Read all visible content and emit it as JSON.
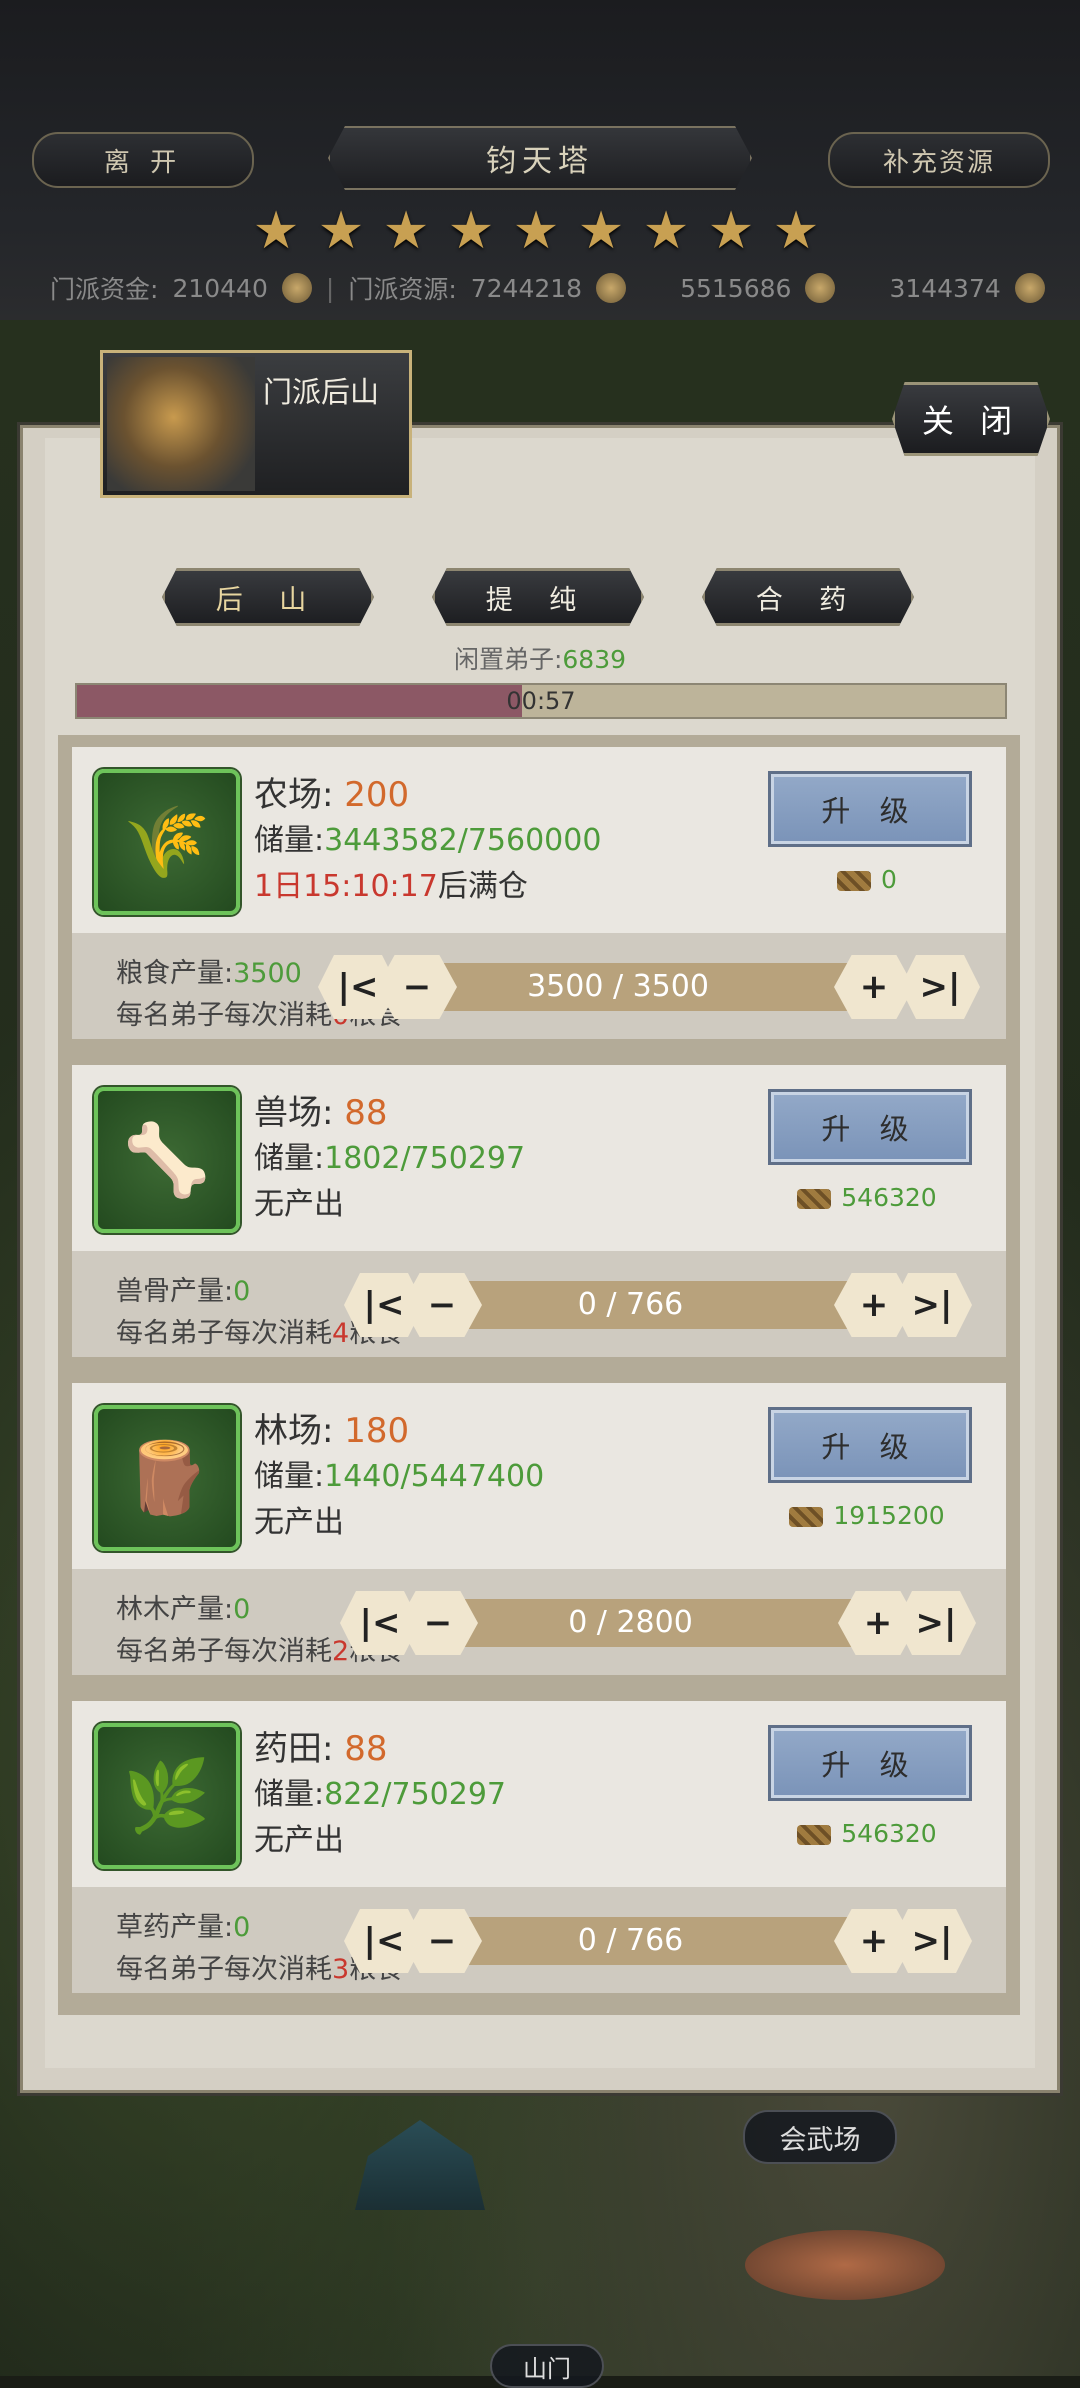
{
  "top": {
    "leave": "离 开",
    "title": "钧天塔",
    "replenish": "补充资源",
    "stars": [
      "★",
      "★",
      "★",
      "★",
      "★",
      "★",
      "★",
      "★",
      "★"
    ],
    "res_label_1": "门派资金:",
    "res_value_1": "210440",
    "res_sep": "|",
    "res_label_2": "门派资源:",
    "res_value_2": "7244218",
    "res_value_3": "5515686",
    "res_value_4": "3144374"
  },
  "panel": {
    "title": "门派后山",
    "close": "关 闭",
    "tabs": [
      "后 山",
      "提 纯",
      "合 药"
    ],
    "idle_label": "闲置弟子:",
    "idle_value": "6839",
    "timer": "00:57",
    "timer_progress": 0.48
  },
  "cards": [
    {
      "name": "农场:",
      "level": "200",
      "store_label": "储量:",
      "store_value": "3443582/7560000",
      "status_red": "1日15:10:17",
      "status_rest": "后满仓",
      "upgrade": "升 级",
      "cost": "0",
      "prod_label": "粮食产量:",
      "prod_value": "3500",
      "consume_pre": "每名弟子每次消耗",
      "consume_num": "0",
      "consume_post": "粮食",
      "stepper": "3500 / 3500",
      "icon": "grain-sacks-icon"
    },
    {
      "name": "兽场:",
      "level": "88",
      "store_label": "储量:",
      "store_value": "1802/750297",
      "status_red": "",
      "status_rest": "无产出",
      "upgrade": "升 级",
      "cost": "546320",
      "prod_label": "兽骨产量:",
      "prod_value": "0",
      "consume_pre": "每名弟子每次消耗",
      "consume_num": "4",
      "consume_post": "粮食",
      "stepper": "0 / 766",
      "icon": "bone-skull-icon"
    },
    {
      "name": "林场:",
      "level": "180",
      "store_label": "储量:",
      "store_value": "1440/5447400",
      "status_red": "",
      "status_rest": "无产出",
      "upgrade": "升 级",
      "cost": "1915200",
      "prod_label": "林木产量:",
      "prod_value": "0",
      "consume_pre": "每名弟子每次消耗",
      "consume_num": "2",
      "consume_post": "粮食",
      "stepper": "0 / 2800",
      "icon": "logs-icon"
    },
    {
      "name": "药田:",
      "level": "88",
      "store_label": "储量:",
      "store_value": "822/750297",
      "status_red": "",
      "status_rest": "无产出",
      "upgrade": "升 级",
      "cost": "546320",
      "prod_label": "草药产量:",
      "prod_value": "0",
      "consume_pre": "每名弟子每次消耗",
      "consume_num": "3",
      "consume_post": "粮食",
      "stepper": "0 / 766",
      "icon": "herb-bowl-icon"
    }
  ],
  "map": {
    "label_1": "会武场",
    "label_2": "山门"
  }
}
